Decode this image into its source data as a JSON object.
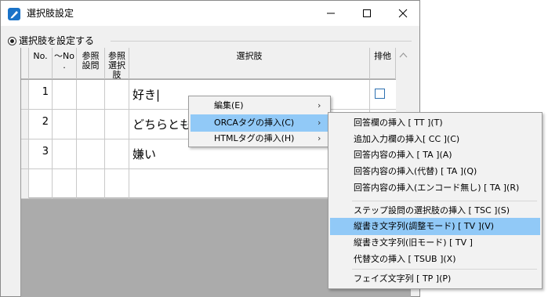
{
  "window": {
    "title": "選択肢設定"
  },
  "group": {
    "label": "選択肢を設定する"
  },
  "grid": {
    "headers": [
      "No.",
      "〜No\n.",
      "参照\n設問",
      "参照\n選択\n肢",
      "選択肢",
      "排他"
    ],
    "rows": [
      {
        "no": "1",
        "choice": "好き|"
      },
      {
        "no": "2",
        "choice": "どちらとも"
      },
      {
        "no": "3",
        "choice": "嫌い"
      }
    ]
  },
  "context_menu": {
    "items": [
      {
        "label": "編集(E)",
        "has_submenu": true
      },
      {
        "label": "ORCAタグの挿入(C)",
        "has_submenu": true,
        "highlighted": true
      },
      {
        "label": "HTMLタグの挿入(H)",
        "has_submenu": true
      }
    ]
  },
  "submenu": {
    "items": [
      "回答欄の挿入 [ TT ](T)",
      "追加入力欄の挿入[ CC ](C)",
      "回答内容の挿入 [ TA ](A)",
      "回答内容の挿入(代替) [ TA ](Q)",
      "回答内容の挿入(エンコード無し) [ TA ](R)",
      "ステップ設問の選択肢の挿入 [ TSC ](S)",
      "縦書き文字列(調整モード) [ TV ](V)",
      "縦書き文字列(旧モード) [ TV ]",
      "代替文の挿入 [ TSUB ](X)",
      "フェイズ文字列 [ TP ](P)"
    ],
    "highlighted_index": 6
  },
  "colors": {
    "highlight": "#91c9f7",
    "app_icon": "#1a73c8"
  }
}
